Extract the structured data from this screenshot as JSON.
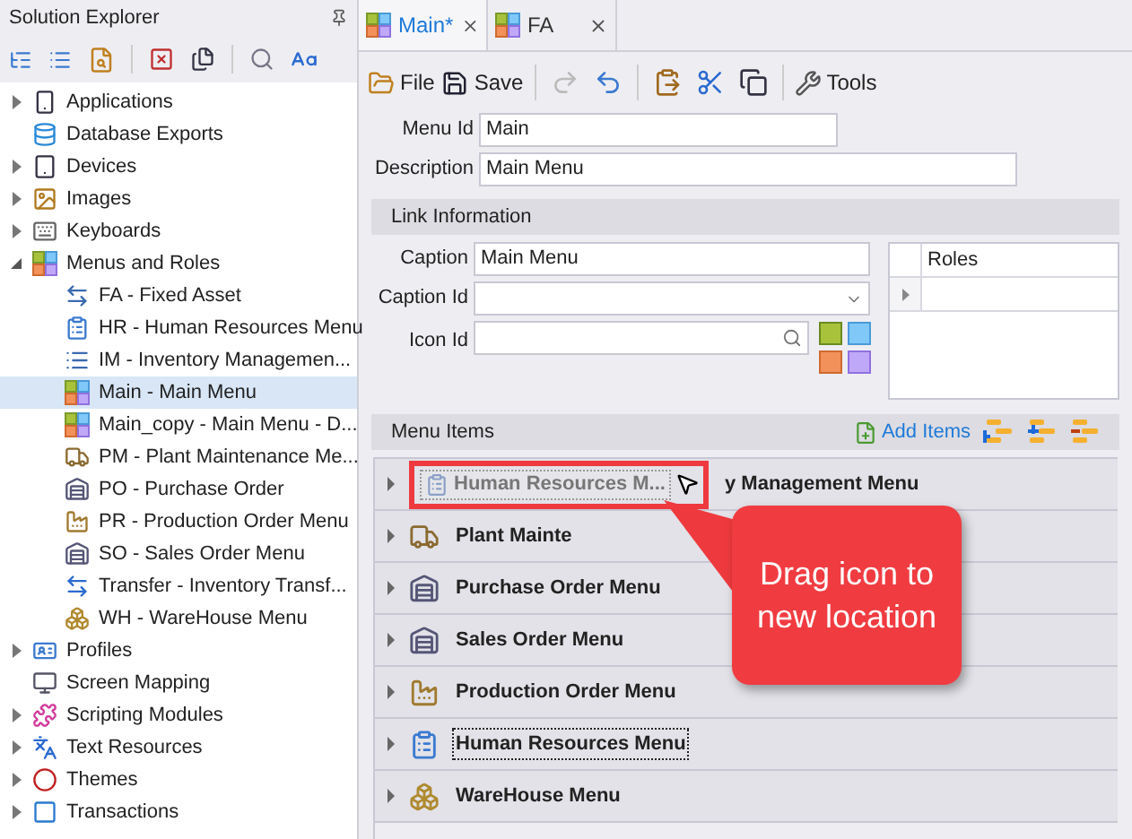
{
  "sidebar": {
    "title": "Solution Explorer",
    "items": [
      {
        "label": "Applications",
        "kind": "group",
        "expanded": false,
        "selected": false
      },
      {
        "label": "Database Exports",
        "kind": "leaf",
        "selected": false
      },
      {
        "label": "Devices",
        "kind": "group",
        "expanded": false,
        "selected": false
      },
      {
        "label": "Images",
        "kind": "group",
        "expanded": false,
        "selected": false
      },
      {
        "label": "Keyboards",
        "kind": "group",
        "expanded": false,
        "selected": false
      },
      {
        "label": "Menus and Roles",
        "kind": "group",
        "expanded": true,
        "selected": false,
        "children": [
          {
            "label": "FA - Fixed Asset",
            "kind": "leaf",
            "selected": false
          },
          {
            "label": "HR - Human Resources Menu",
            "kind": "leaf",
            "selected": false
          },
          {
            "label": "IM - Inventory Managemen...",
            "kind": "leaf",
            "selected": false
          },
          {
            "label": "Main - Main Menu",
            "kind": "leaf",
            "selected": true
          },
          {
            "label": "Main_copy - Main Menu - D...",
            "kind": "leaf",
            "selected": false
          },
          {
            "label": "PM - Plant Maintenance Me...",
            "kind": "leaf",
            "selected": false
          },
          {
            "label": "PO - Purchase Order",
            "kind": "leaf",
            "selected": false
          },
          {
            "label": "PR - Production Order Menu",
            "kind": "leaf",
            "selected": false
          },
          {
            "label": "SO - Sales Order Menu",
            "kind": "leaf",
            "selected": false
          },
          {
            "label": "Transfer - Inventory Transf...",
            "kind": "leaf",
            "selected": false
          },
          {
            "label": "WH - WareHouse Menu",
            "kind": "leaf",
            "selected": false
          }
        ]
      },
      {
        "label": "Profiles",
        "kind": "group",
        "expanded": false,
        "selected": false
      },
      {
        "label": "Screen Mapping",
        "kind": "leaf",
        "selected": false
      },
      {
        "label": "Scripting Modules",
        "kind": "group",
        "expanded": false,
        "selected": false
      },
      {
        "label": "Text Resources",
        "kind": "group",
        "expanded": false,
        "selected": false
      },
      {
        "label": "Themes",
        "kind": "group",
        "expanded": false,
        "selected": false
      },
      {
        "label": "Transactions",
        "kind": "group",
        "expanded": false,
        "selected": false
      }
    ]
  },
  "tabs": [
    {
      "label": "Main*",
      "selected": true
    },
    {
      "label": "FA",
      "selected": false
    }
  ],
  "toolbar": [
    {
      "kind": "labeled",
      "label": "File",
      "disabled": false
    },
    {
      "kind": "labeled",
      "label": "Save",
      "disabled": false
    },
    {
      "kind": "separator"
    },
    {
      "kind": "icon",
      "disabled": true
    },
    {
      "kind": "icon",
      "disabled": false
    },
    {
      "kind": "separator"
    },
    {
      "kind": "icon",
      "disabled": false
    },
    {
      "kind": "icon",
      "disabled": false
    },
    {
      "kind": "icon",
      "disabled": false
    },
    {
      "kind": "separator"
    },
    {
      "kind": "labeled",
      "label": "Tools",
      "disabled": false
    }
  ],
  "menu_id": {
    "label": "Menu Id",
    "value": "Main"
  },
  "description": {
    "label": "Description",
    "value": "Main Menu"
  },
  "link_information": {
    "title": "Link Information",
    "caption": {
      "label": "Caption",
      "value": "Main Menu"
    },
    "caption_id": {
      "label": "Caption Id"
    },
    "icon_id": {
      "label": "Icon Id"
    }
  },
  "roles": {
    "column": "Roles"
  },
  "menu_items": {
    "title": "Menu Items",
    "add_items": "Add Items",
    "rows": [
      {
        "label": "y Management Menu",
        "drag_preview": "Human Resources M...",
        "focused": false
      },
      {
        "label": "Plant Mainte",
        "focused": false
      },
      {
        "label": "Purchase Order Menu",
        "focused": false
      },
      {
        "label": "Sales Order Menu",
        "focused": false
      },
      {
        "label": "Production Order Menu",
        "focused": false
      },
      {
        "label": "Human Resources Menu",
        "focused": true
      },
      {
        "label": "WareHouse Menu",
        "focused": false
      }
    ]
  },
  "callout": {
    "text": "Drag icon to new location"
  }
}
